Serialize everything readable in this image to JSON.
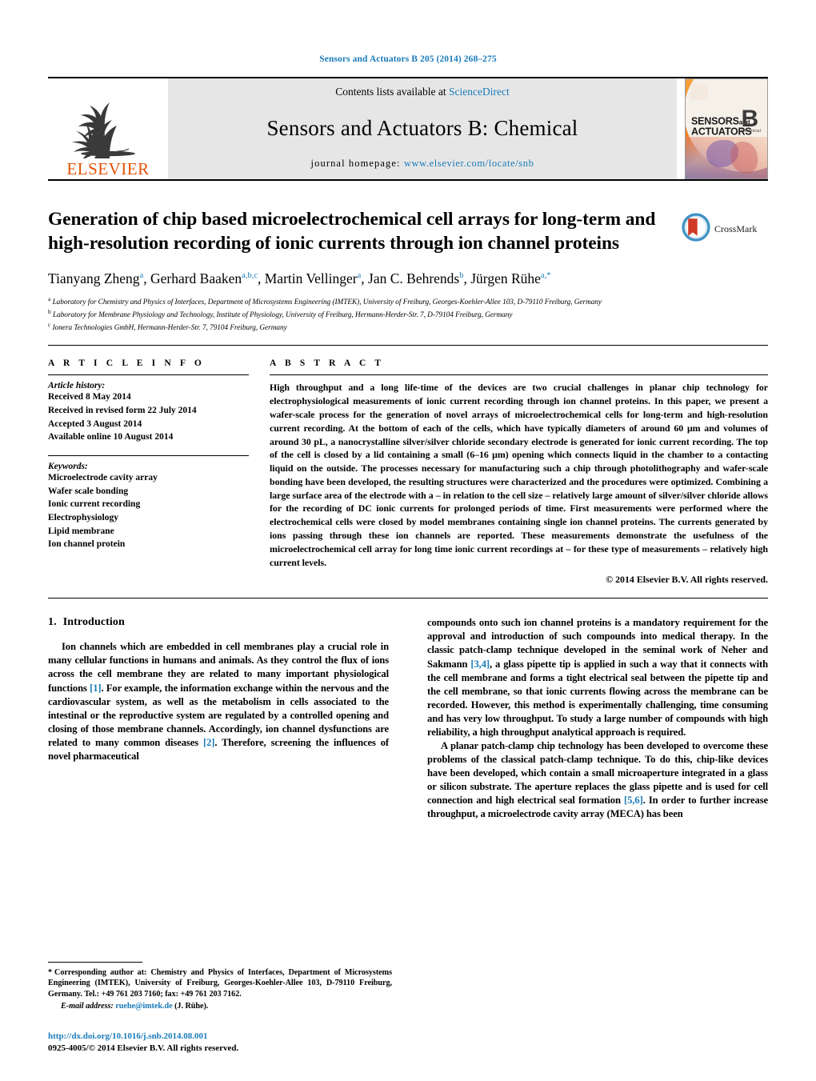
{
  "running_head": "Sensors and Actuators B 205 (2014) 268–275",
  "masthead": {
    "publisher": "ELSEVIER",
    "contents_prefix": "Contents lists available at ",
    "contents_link": "ScienceDirect",
    "journal_title": "Sensors and Actuators B: Chemical",
    "homepage_prefix": "journal homepage:",
    "homepage_url": "www.elsevier.com/locate/snb",
    "cover": {
      "line1": "SENSORS",
      "line1_small": "and",
      "line2": "ACTUATORS",
      "letter": "B",
      "letter_sub": "Chemical"
    }
  },
  "article": {
    "title": "Generation of chip based microelectrochemical cell arrays for long-term and high-resolution recording of ionic currents through ion channel proteins",
    "crossmark_label": "CrossMark",
    "authors": [
      {
        "name": "Tianyang Zheng",
        "sup": "a",
        "sep": ", "
      },
      {
        "name": "Gerhard Baaken",
        "sup": "a,b,c",
        "sep": ", "
      },
      {
        "name": "Martin Vellinger",
        "sup": "a",
        "sep": ", "
      },
      {
        "name": "Jan C. Behrends",
        "sup": "b",
        "sep": ", "
      },
      {
        "name": "Jürgen Rühe",
        "sup": "a,*",
        "sep": ""
      }
    ],
    "affiliations": [
      {
        "marker": "a",
        "text": "Laboratory for Chemistry and Physics of Interfaces, Department of Microsystems Engineering (IMTEK), University of Freiburg, Georges-Koehler-Allee 103, D-79110 Freiburg, Germany"
      },
      {
        "marker": "b",
        "text": "Laboratory for Membrane Physiology and Technology, Institute of Physiology, University of Freiburg, Hermann-Herder-Str. 7, D-79104 Freiburg, Germany"
      },
      {
        "marker": "c",
        "text": "Ionera Technologies GmbH, Hermann-Herder-Str. 7, 79104 Freiburg, Germany"
      }
    ]
  },
  "article_info": {
    "heading": "A R T I C L E   I N F O",
    "history_label": "Article history:",
    "history": [
      "Received 8 May 2014",
      "Received in revised form 22 July 2014",
      "Accepted 3 August 2014",
      "Available online 10 August 2014"
    ],
    "keywords_label": "Keywords:",
    "keywords": [
      "Microelectrode cavity array",
      "Wafer scale bonding",
      "Ionic current recording",
      "Electrophysiology",
      "Lipid membrane",
      "Ion channel protein"
    ]
  },
  "abstract": {
    "heading": "A B S T R A C T",
    "text": "High throughput and a long life-time of the devices are two crucial challenges in planar chip technology for electrophysiological measurements of ionic current recording through ion channel proteins. In this paper, we present a wafer-scale process for the generation of novel arrays of microelectrochemical cells for long-term and high-resolution current recording. At the bottom of each of the cells, which have typically diameters of around 60 μm and volumes of around 30 pL, a nanocrystalline silver/silver chloride secondary electrode is generated for ionic current recording. The top of the cell is closed by a lid containing a small (6–16 μm) opening which connects liquid in the chamber to a contacting liquid on the outside. The processes necessary for manufacturing such a chip through photolithography and wafer-scale bonding have been developed, the resulting structures were characterized and the procedures were optimized. Combining a large surface area of the electrode with a – in relation to the cell size – relatively large amount of silver/silver chloride allows for the recording of DC ionic currents for prolonged periods of time. First measurements were performed where the electrochemical cells were closed by model membranes containing single ion channel proteins. The currents generated by ions passing through these ion channels are reported. These measurements demonstrate the usefulness of the microelectrochemical cell array for long time ionic current recordings at – for these type of measurements – relatively high current levels.",
    "copyright": "© 2014 Elsevier B.V. All rights reserved."
  },
  "introduction": {
    "number": "1.",
    "title": "Introduction",
    "left_p1_a": "Ion channels which are embedded in cell membranes play a crucial role in many cellular functions in humans and animals. As they control the flux of ions across the cell membrane they are related to many important physiological functions ",
    "left_cite1": "[1]",
    "left_p1_b": ". For example, the information exchange within the nervous and the cardiovascular system, as well as the metabolism in cells associated to the intestinal or the reproductive system are regulated by a controlled opening and closing of those membrane channels. Accordingly, ion channel dysfunctions are related to many common diseases ",
    "left_cite2": "[2]",
    "left_p1_c": ". Therefore, screening the influences of novel pharmaceutical",
    "right_p1_a": "compounds onto such ion channel proteins is a mandatory requirement for the approval and introduction of such compounds into medical therapy. In the classic patch-clamp technique developed in the seminal work of Neher and Sakmann ",
    "right_cite1": "[3,4]",
    "right_p1_b": ", a glass pipette tip is applied in such a way that it connects with the cell membrane and forms a tight electrical seal between the pipette tip and the cell membrane, so that ionic currents flowing across the membrane can be recorded. However, this method is experimentally challenging, time consuming and has very low throughput. To study a large number of compounds with high reliability, a high throughput analytical approach is required.",
    "right_p2_a": "A planar patch-clamp chip technology has been developed to overcome these problems of the classical patch-clamp technique. To do this, chip-like devices have been developed, which contain a small microaperture integrated in a glass or silicon substrate. The aperture replaces the glass pipette and is used for cell connection and high electrical seal formation ",
    "right_cite2": "[5,6]",
    "right_p2_b": ". In order to further increase throughput, a microelectrode cavity array (MECA) has been"
  },
  "footnote": {
    "star": "*",
    "corresponding": "Corresponding author at: Chemistry and Physics of Interfaces, Department of Microsystems Engineering (IMTEK), University of Freiburg, Georges-Koehler-Allee 103, D-79110 Freiburg, Germany. Tel.: +49 761 203 7160; fax: +49 761 203 7162.",
    "email_label": "E-mail address:",
    "email": "ruehe@imtek.de",
    "email_suffix": " (J. Rühe).",
    "doi": "http://dx.doi.org/10.1016/j.snb.2014.08.001",
    "issn": "0925-4005/© 2014 Elsevier B.V. All rights reserved."
  },
  "colors": {
    "link": "#1a7bb9",
    "elsevier_orange": "#E35205",
    "band_gray": "#e6e6e6"
  }
}
